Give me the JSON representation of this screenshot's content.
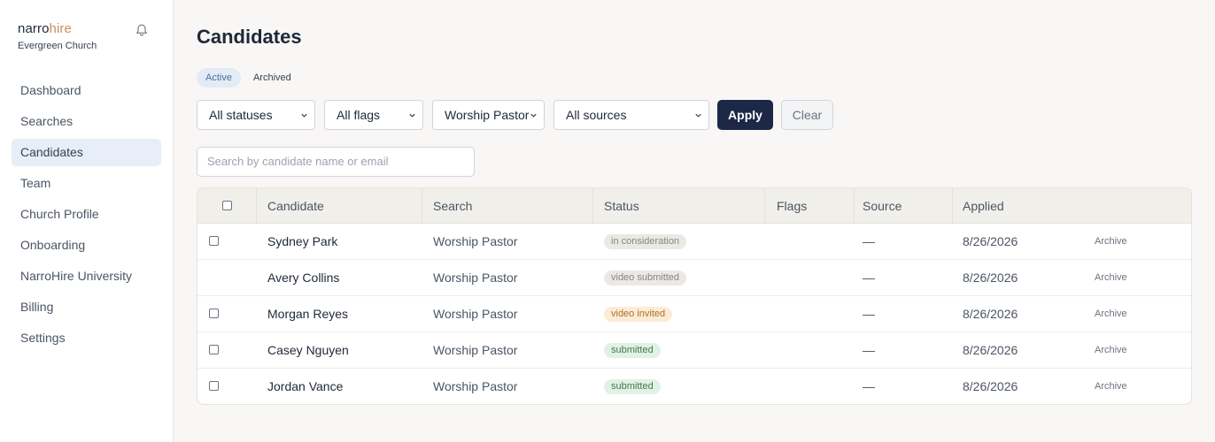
{
  "brand": {
    "logo_primary": "narro",
    "logo_accent": "hire",
    "org_name": "Evergreen Church",
    "accent_color": "#c98f5a"
  },
  "header_icons": {
    "notifications": "bell-icon"
  },
  "sidebar": {
    "items": [
      {
        "label": "Dashboard",
        "active": false
      },
      {
        "label": "Searches",
        "active": false
      },
      {
        "label": "Candidates",
        "active": true
      },
      {
        "label": "Team",
        "active": false
      },
      {
        "label": "Church Profile",
        "active": false
      },
      {
        "label": "Onboarding",
        "active": false
      },
      {
        "label": "NarroHire University",
        "active": false
      },
      {
        "label": "Billing",
        "active": false
      },
      {
        "label": "Settings",
        "active": false
      }
    ]
  },
  "page": {
    "title": "Candidates"
  },
  "tabs": [
    {
      "label": "Active",
      "active": true
    },
    {
      "label": "Archived",
      "active": false
    }
  ],
  "filters": {
    "status": "All statuses",
    "flags": "All flags",
    "search": "Worship Pastor",
    "source": "All sources",
    "apply_label": "Apply",
    "clear_label": "Clear"
  },
  "search": {
    "placeholder": "Search by candidate name or email"
  },
  "table": {
    "headers": {
      "candidate": "Candidate",
      "search": "Search",
      "status": "Status",
      "flags": "Flags",
      "source": "Source",
      "applied": "Applied"
    },
    "rows": [
      {
        "checkbox": true,
        "candidate": "Sydney Park",
        "search": "Worship Pastor",
        "status": "in consideration",
        "status_type": "neutral",
        "flags": "",
        "source": "—",
        "applied": "8/26/2026",
        "action": "Archive"
      },
      {
        "checkbox": false,
        "candidate": "Avery Collins",
        "search": "Worship Pastor",
        "status": "video submitted",
        "status_type": "neutral",
        "flags": "",
        "source": "—",
        "applied": "8/26/2026",
        "action": "Archive"
      },
      {
        "checkbox": true,
        "candidate": "Morgan Reyes",
        "search": "Worship Pastor",
        "status": "video invited",
        "status_type": "warning",
        "flags": "",
        "source": "—",
        "applied": "8/26/2026",
        "action": "Archive"
      },
      {
        "checkbox": true,
        "candidate": "Casey Nguyen",
        "search": "Worship Pastor",
        "status": "submitted",
        "status_type": "success",
        "flags": "",
        "source": "—",
        "applied": "8/26/2026",
        "action": "Archive"
      },
      {
        "checkbox": true,
        "candidate": "Jordan Vance",
        "search": "Worship Pastor",
        "status": "submitted",
        "status_type": "success",
        "flags": "",
        "source": "—",
        "applied": "8/26/2026",
        "action": "Archive"
      }
    ]
  },
  "colors": {
    "primary_button": "#1c2845",
    "badge_neutral_bg": "#ebe9e5",
    "badge_neutral_text": "#8a8680",
    "badge_warning_bg": "#fbecd6",
    "badge_warning_text": "#b0702a",
    "badge_success_bg": "#e2f1e5",
    "badge_success_text": "#3f7a4d"
  }
}
